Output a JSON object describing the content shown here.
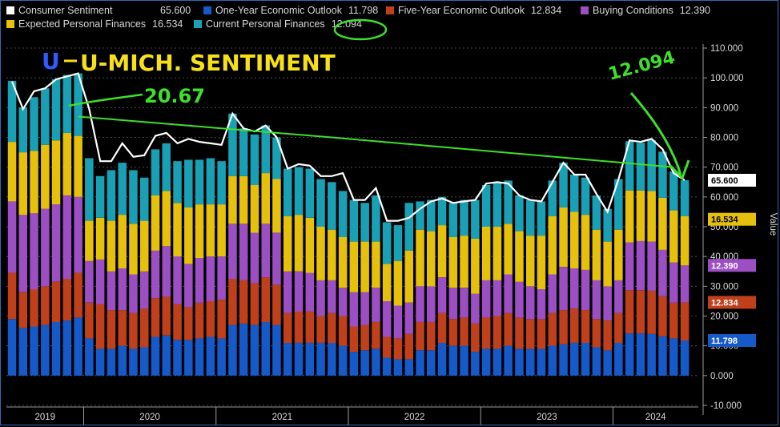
{
  "legend": [
    {
      "label": "Consumer Sentiment",
      "value": "65.600",
      "color": "#ffffff"
    },
    {
      "label": "One-Year Economic Outlook",
      "value": "11.798",
      "color": "#1659c9"
    },
    {
      "label": "Five-Year Economic Outlook",
      "value": "12.834",
      "color": "#c0401c"
    },
    {
      "label": "Buying Conditions",
      "value": "12.390",
      "color": "#9b4fc2"
    },
    {
      "label": "Expected Personal Finances",
      "value": "16.534",
      "color": "#e5c00c"
    },
    {
      "label": "Current Personal Finances",
      "value": "12.094",
      "color": "#1aa0b5"
    }
  ],
  "annotations": {
    "title": "U-MICH. SENTIMENT",
    "peak": "20.67",
    "latest": "12.094"
  },
  "value_tags": [
    {
      "value": "65.600",
      "bg": "#ffffff",
      "fg": "#000000",
      "y": 65.6
    },
    {
      "value": "16.534",
      "bg": "#e5c00c",
      "fg": "#000000",
      "y": 52.5
    },
    {
      "value": "12.390",
      "bg": "#9b4fc2",
      "fg": "#ffffff",
      "y": 37.0
    },
    {
      "value": "12.834",
      "bg": "#c0401c",
      "fg": "#ffffff",
      "y": 24.6
    },
    {
      "value": "11.798",
      "bg": "#1659c9",
      "fg": "#ffffff",
      "y": 11.8
    }
  ],
  "chart_data": {
    "type": "bar",
    "stacked": true,
    "ylabel": "Value",
    "ylim": [
      -10,
      110
    ],
    "yticks": [
      "-10.000",
      "0.000",
      "10.000",
      "20.000",
      "30.000",
      "40.000",
      "50.000",
      "60.000",
      "70.000",
      "80.000",
      "90.000",
      "100.000",
      "110.000"
    ],
    "x_years": [
      "2019",
      "2020",
      "2021",
      "2022",
      "2023",
      "2024"
    ],
    "first_year_start_index": 0,
    "year_start_indices": [
      0,
      7,
      19,
      31,
      43,
      55
    ],
    "series": [
      {
        "name": "One-Year Economic Outlook",
        "color": "#1659c9",
        "values": [
          19,
          16,
          16.5,
          17,
          18,
          18.5,
          19.5,
          12.5,
          9,
          9,
          10,
          9,
          9.5,
          13,
          13.5,
          12,
          12,
          12.5,
          13,
          12.5,
          17,
          17.5,
          17,
          18,
          17,
          11,
          11,
          11,
          11,
          11,
          10,
          8,
          8.5,
          9,
          6,
          5.5,
          5.5,
          8.5,
          8.5,
          11,
          10,
          10,
          8,
          9,
          9,
          10,
          9,
          9,
          9,
          10,
          10.5,
          11,
          11,
          9.5,
          8.5,
          11,
          14.2,
          14.2,
          14,
          13.2,
          12.5,
          11.8
        ]
      },
      {
        "name": "Five-Year Economic Outlook",
        "color": "#c0401c",
        "values": [
          15.5,
          12,
          12.5,
          13,
          13.5,
          14,
          15,
          12,
          15,
          13,
          12,
          12,
          13,
          13,
          13,
          12,
          11,
          12,
          12,
          13,
          15.5,
          14.5,
          14,
          15,
          13.5,
          10,
          10.5,
          10.5,
          9,
          10,
          10,
          8.5,
          8.5,
          9,
          7,
          7,
          8.5,
          9.5,
          9.5,
          10,
          9,
          9.5,
          9.5,
          10.5,
          11,
          11,
          10.5,
          10,
          10,
          11,
          11.5,
          11.5,
          11,
          9.5,
          10,
          10,
          14.5,
          14.5,
          14.5,
          13.5,
          12,
          12.8
        ]
      },
      {
        "name": "Buying Conditions",
        "color": "#9b4fc2",
        "values": [
          24,
          26,
          25.5,
          26,
          26,
          28,
          25.5,
          14,
          15,
          13,
          14,
          13,
          12.5,
          16,
          17,
          16,
          14.5,
          15,
          15,
          14.5,
          18.5,
          19,
          17,
          18,
          17.5,
          14,
          13.5,
          13,
          12,
          11,
          9.5,
          11.5,
          11,
          11.5,
          12,
          11,
          10.5,
          12,
          12,
          12,
          10.5,
          10,
          10,
          12.5,
          12,
          13,
          12,
          11,
          10,
          13,
          14.5,
          13.5,
          13.5,
          13,
          11.5,
          11,
          16,
          16.5,
          16.5,
          15.5,
          13.5,
          12.4
        ]
      },
      {
        "name": "Expected Personal Finances",
        "color": "#e5c00c",
        "values": [
          20,
          21,
          21,
          21.5,
          21.5,
          21,
          20.5,
          13.5,
          14,
          17,
          18,
          17,
          17,
          18.5,
          18.5,
          18,
          19,
          18,
          17.5,
          17.5,
          16,
          16,
          16,
          17,
          18,
          18.5,
          19,
          18.5,
          18,
          17,
          17,
          17,
          17,
          15.5,
          12.5,
          15,
          17.5,
          19,
          18.5,
          17.5,
          17,
          17.5,
          18.5,
          18,
          18,
          17,
          17,
          17,
          18,
          19.5,
          20,
          19,
          18.5,
          17,
          15,
          17,
          17.5,
          17,
          17,
          17.5,
          17.5,
          16.5
        ]
      },
      {
        "name": "Current Personal Finances",
        "color": "#1aa0b5",
        "values": [
          20.5,
          15,
          18,
          19,
          20.5,
          19.5,
          21,
          21,
          14,
          17,
          17.5,
          18,
          14.5,
          15.5,
          16,
          14,
          16,
          15,
          15.5,
          14.5,
          21,
          16,
          17,
          16,
          14,
          16,
          16,
          16.5,
          16,
          16,
          15.5,
          14,
          13,
          15.5,
          14,
          12,
          16,
          9.5,
          10.5,
          9.5,
          11.5,
          12,
          13,
          14,
          15,
          14.5,
          12,
          12,
          11.5,
          12,
          15,
          12.5,
          12.5,
          11.5,
          11,
          17,
          16.5,
          16,
          17,
          15.5,
          13,
          12.1
        ]
      }
    ],
    "sentiment": [
      98.8,
      89.5,
      95.5,
      96.5,
      99.5,
      100.5,
      101.5,
      89.5,
      72,
      72,
      78,
      73.5,
      74,
      80.5,
      81.5,
      78,
      79.5,
      78.5,
      78,
      77.5,
      88,
      83,
      82,
      84,
      80,
      69.5,
      71,
      70.5,
      67,
      67,
      68,
      59,
      59,
      63,
      52,
      52,
      53,
      56,
      58.5,
      59.5,
      58,
      58.5,
      59,
      64.5,
      65,
      64.5,
      60.5,
      59,
      58.5,
      65,
      71.5,
      67.5,
      67.5,
      61,
      55,
      66,
      79,
      78.5,
      79.5,
      76,
      68,
      65.6
    ],
    "trend": {
      "x": [
        6,
        29,
        60
      ],
      "y": [
        87,
        80,
        70
      ]
    }
  }
}
